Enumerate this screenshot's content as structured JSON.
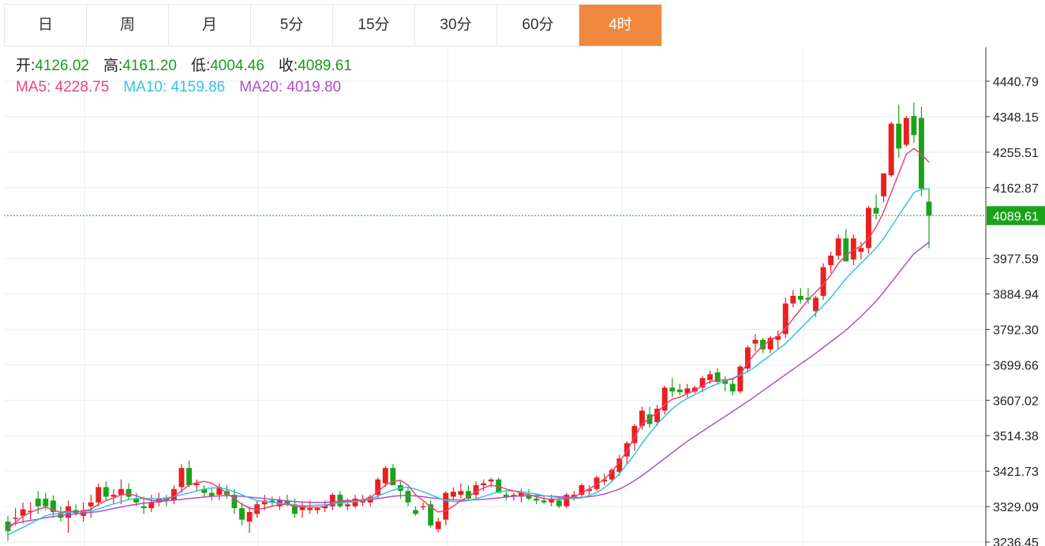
{
  "tabs": [
    "日",
    "周",
    "月",
    "5分",
    "15分",
    "30分",
    "60分",
    "4时"
  ],
  "active_tab": "4时",
  "ohlc": {
    "open_label": "开:",
    "open": "4126.02",
    "high_label": "高:",
    "high": "4161.20",
    "low_label": "低:",
    "low": "4004.46",
    "close_label": "收:",
    "close": "4089.61"
  },
  "ma": {
    "ma5_label": "MA5:",
    "ma5": "4228.75",
    "ma10_label": "MA10:",
    "ma10": "4159.86",
    "ma20_label": "MA20:",
    "ma20": "4019.80"
  },
  "colors": {
    "up": "#e8201f",
    "down": "#1aa31a",
    "ma5": "#e8457a",
    "ma10": "#33c4e0",
    "ma20": "#b14fc8",
    "active_tab": "#f08840",
    "price_tag": "#1aa31a",
    "grid": "#e8eef2"
  },
  "chart_data": {
    "type": "candlestick",
    "y_ticks": [
      "4440.79",
      "4348.15",
      "4255.51",
      "4162.87",
      "3977.59",
      "3884.94",
      "3792.30",
      "3699.66",
      "3607.02",
      "3514.38",
      "3421.73",
      "3329.09",
      "3236.45"
    ],
    "ylim": [
      3236.45,
      4440.79
    ],
    "current_price": "4089.61",
    "candles": [
      [
        3290,
        3305,
        3240,
        3265
      ],
      [
        3300,
        3325,
        3280,
        3300
      ],
      [
        3305,
        3340,
        3285,
        3322
      ],
      [
        3315,
        3340,
        3295,
        3318
      ],
      [
        3350,
        3370,
        3310,
        3330
      ],
      [
        3350,
        3365,
        3320,
        3330
      ],
      [
        3345,
        3358,
        3300,
        3315
      ],
      [
        3310,
        3330,
        3290,
        3300
      ],
      [
        3300,
        3345,
        3260,
        3330
      ],
      [
        3320,
        3335,
        3305,
        3312
      ],
      [
        3305,
        3340,
        3290,
        3320
      ],
      [
        3330,
        3360,
        3300,
        3340
      ],
      [
        3340,
        3390,
        3330,
        3380
      ],
      [
        3380,
        3395,
        3345,
        3355
      ],
      [
        3355,
        3375,
        3335,
        3360
      ],
      [
        3360,
        3400,
        3335,
        3375
      ],
      [
        3375,
        3390,
        3345,
        3355
      ],
      [
        3350,
        3365,
        3330,
        3340
      ],
      [
        3330,
        3355,
        3310,
        3325
      ],
      [
        3325,
        3360,
        3315,
        3340
      ],
      [
        3340,
        3365,
        3330,
        3350
      ],
      [
        3350,
        3360,
        3330,
        3345
      ],
      [
        3345,
        3385,
        3335,
        3375
      ],
      [
        3380,
        3440,
        3365,
        3430
      ],
      [
        3430,
        3450,
        3380,
        3385
      ],
      [
        3385,
        3400,
        3370,
        3390
      ],
      [
        3375,
        3385,
        3355,
        3365
      ],
      [
        3365,
        3380,
        3345,
        3355
      ],
      [
        3360,
        3390,
        3345,
        3380
      ],
      [
        3370,
        3385,
        3350,
        3360
      ],
      [
        3360,
        3375,
        3310,
        3325
      ],
      [
        3325,
        3340,
        3280,
        3295
      ],
      [
        3290,
        3330,
        3260,
        3315
      ],
      [
        3310,
        3345,
        3300,
        3335
      ],
      [
        3335,
        3360,
        3320,
        3345
      ],
      [
        3345,
        3355,
        3330,
        3340
      ],
      [
        3330,
        3355,
        3320,
        3345
      ],
      [
        3345,
        3360,
        3330,
        3335
      ],
      [
        3335,
        3350,
        3300,
        3310
      ],
      [
        3320,
        3340,
        3300,
        3330
      ],
      [
        3320,
        3345,
        3310,
        3325
      ],
      [
        3320,
        3330,
        3310,
        3325
      ],
      [
        3325,
        3345,
        3315,
        3330
      ],
      [
        3330,
        3365,
        3320,
        3360
      ],
      [
        3360,
        3370,
        3325,
        3330
      ],
      [
        3330,
        3350,
        3320,
        3335
      ],
      [
        3330,
        3360,
        3325,
        3350
      ],
      [
        3340,
        3360,
        3330,
        3345
      ],
      [
        3340,
        3360,
        3330,
        3355
      ],
      [
        3360,
        3405,
        3350,
        3400
      ],
      [
        3390,
        3435,
        3380,
        3430
      ],
      [
        3430,
        3440,
        3385,
        3385
      ],
      [
        3385,
        3395,
        3350,
        3370
      ],
      [
        3370,
        3380,
        3330,
        3340
      ],
      [
        3320,
        3330,
        3305,
        3310
      ],
      [
        3330,
        3340,
        3320,
        3330
      ],
      [
        3335,
        3345,
        3275,
        3280
      ],
      [
        3270,
        3300,
        3262,
        3290
      ],
      [
        3295,
        3370,
        3280,
        3365
      ],
      [
        3355,
        3380,
        3345,
        3368
      ],
      [
        3360,
        3390,
        3350,
        3370
      ],
      [
        3370,
        3385,
        3345,
        3350
      ],
      [
        3360,
        3395,
        3350,
        3385
      ],
      [
        3385,
        3400,
        3370,
        3390
      ],
      [
        3395,
        3405,
        3380,
        3400
      ],
      [
        3400,
        3405,
        3365,
        3365
      ],
      [
        3360,
        3370,
        3345,
        3355
      ],
      [
        3355,
        3365,
        3345,
        3360
      ],
      [
        3355,
        3375,
        3340,
        3365
      ],
      [
        3360,
        3375,
        3345,
        3350
      ],
      [
        3350,
        3360,
        3335,
        3345
      ],
      [
        3345,
        3355,
        3335,
        3340
      ],
      [
        3340,
        3360,
        3330,
        3350
      ],
      [
        3345,
        3355,
        3325,
        3330
      ],
      [
        3330,
        3365,
        3325,
        3360
      ],
      [
        3355,
        3370,
        3345,
        3360
      ],
      [
        3360,
        3390,
        3350,
        3385
      ],
      [
        3370,
        3385,
        3360,
        3375
      ],
      [
        3375,
        3410,
        3370,
        3405
      ],
      [
        3395,
        3415,
        3385,
        3400
      ],
      [
        3400,
        3430,
        3395,
        3425
      ],
      [
        3420,
        3465,
        3410,
        3455
      ],
      [
        3460,
        3500,
        3440,
        3495
      ],
      [
        3495,
        3545,
        3475,
        3540
      ],
      [
        3540,
        3590,
        3530,
        3580
      ],
      [
        3570,
        3590,
        3535,
        3545
      ],
      [
        3550,
        3595,
        3540,
        3585
      ],
      [
        3580,
        3645,
        3570,
        3640
      ],
      [
        3640,
        3665,
        3615,
        3630
      ],
      [
        3635,
        3650,
        3620,
        3628
      ],
      [
        3625,
        3650,
        3615,
        3638
      ],
      [
        3630,
        3645,
        3625,
        3640
      ],
      [
        3640,
        3670,
        3628,
        3665
      ],
      [
        3660,
        3685,
        3650,
        3675
      ],
      [
        3680,
        3690,
        3650,
        3655
      ],
      [
        3660,
        3670,
        3630,
        3650
      ],
      [
        3650,
        3665,
        3620,
        3630
      ],
      [
        3630,
        3700,
        3625,
        3695
      ],
      [
        3690,
        3750,
        3680,
        3745
      ],
      [
        3755,
        3780,
        3735,
        3765
      ],
      [
        3765,
        3770,
        3730,
        3740
      ],
      [
        3740,
        3775,
        3730,
        3770
      ],
      [
        3765,
        3790,
        3740,
        3775
      ],
      [
        3780,
        3875,
        3770,
        3860
      ],
      [
        3860,
        3895,
        3850,
        3880
      ],
      [
        3880,
        3900,
        3860,
        3870
      ],
      [
        3875,
        3900,
        3860,
        3870
      ],
      [
        3840,
        3880,
        3825,
        3875
      ],
      [
        3880,
        3965,
        3870,
        3955
      ],
      [
        3960,
        3995,
        3940,
        3985
      ],
      [
        3985,
        4040,
        3975,
        4030
      ],
      [
        4030,
        4055,
        3970,
        3970
      ],
      [
        3975,
        4040,
        3960,
        4030
      ],
      [
        3995,
        4020,
        3975,
        4005
      ],
      [
        4005,
        4115,
        3990,
        4110
      ],
      [
        4110,
        4145,
        4080,
        4095
      ],
      [
        4140,
        4200,
        4125,
        4200
      ],
      [
        4195,
        4335,
        4190,
        4330
      ],
      [
        4330,
        4380,
        4240,
        4265
      ],
      [
        4275,
        4350,
        4270,
        4345
      ],
      [
        4350,
        4385,
        4280,
        4300
      ],
      [
        4345,
        4375,
        4140,
        4160
      ],
      [
        4126.02,
        4161.2,
        4004.46,
        4089.61
      ]
    ],
    "ma5": [
      3270,
      3288,
      3304,
      3314,
      3322,
      3328,
      3320,
      3314,
      3318,
      3315,
      3318,
      3322,
      3335,
      3345,
      3352,
      3360,
      3362,
      3358,
      3350,
      3345,
      3345,
      3348,
      3355,
      3370,
      3385,
      3392,
      3395,
      3390,
      3378,
      3365,
      3350,
      3335,
      3325,
      3322,
      3325,
      3330,
      3335,
      3335,
      3330,
      3328,
      3328,
      3327,
      3330,
      3338,
      3345,
      3345,
      3345,
      3347,
      3352,
      3368,
      3385,
      3395,
      3398,
      3385,
      3360,
      3345,
      3328,
      3315,
      3318,
      3330,
      3345,
      3355,
      3368,
      3378,
      3385,
      3382,
      3375,
      3370,
      3365,
      3360,
      3355,
      3350,
      3348,
      3348,
      3350,
      3355,
      3365,
      3375,
      3388,
      3400,
      3420,
      3445,
      3475,
      3510,
      3545,
      3560,
      3575,
      3595,
      3610,
      3615,
      3625,
      3632,
      3645,
      3655,
      3660,
      3660,
      3662,
      3675,
      3705,
      3730,
      3750,
      3765,
      3775,
      3795,
      3820,
      3845,
      3870,
      3890,
      3910,
      3935,
      3965,
      3985,
      4000,
      4010,
      4030,
      4060,
      4100,
      4150,
      4200,
      4250,
      4265,
      4250,
      4229
    ],
    "ma10": [
      3255,
      3265,
      3275,
      3285,
      3295,
      3305,
      3310,
      3312,
      3314,
      3315,
      3316,
      3318,
      3323,
      3330,
      3336,
      3342,
      3348,
      3350,
      3350,
      3350,
      3350,
      3352,
      3355,
      3360,
      3365,
      3370,
      3375,
      3378,
      3378,
      3375,
      3368,
      3360,
      3352,
      3345,
      3342,
      3340,
      3338,
      3336,
      3333,
      3332,
      3332,
      3333,
      3334,
      3336,
      3338,
      3340,
      3342,
      3345,
      3350,
      3356,
      3365,
      3372,
      3378,
      3380,
      3375,
      3368,
      3360,
      3352,
      3345,
      3342,
      3342,
      3345,
      3350,
      3355,
      3362,
      3368,
      3370,
      3370,
      3368,
      3365,
      3362,
      3358,
      3355,
      3352,
      3350,
      3350,
      3352,
      3358,
      3366,
      3378,
      3395,
      3415,
      3440,
      3465,
      3495,
      3520,
      3545,
      3565,
      3585,
      3600,
      3612,
      3622,
      3632,
      3642,
      3650,
      3658,
      3665,
      3672,
      3682,
      3695,
      3710,
      3725,
      3740,
      3755,
      3775,
      3795,
      3815,
      3835,
      3855,
      3875,
      3900,
      3925,
      3945,
      3965,
      3985,
      4005,
      4030,
      4060,
      4090,
      4120,
      4150,
      4158,
      4160
    ],
    "ma20": [
      3280,
      3285,
      3290,
      3293,
      3296,
      3300,
      3303,
      3306,
      3308,
      3310,
      3312,
      3314,
      3316,
      3320,
      3324,
      3328,
      3332,
      3335,
      3338,
      3340,
      3342,
      3344,
      3346,
      3348,
      3350,
      3352,
      3354,
      3356,
      3357,
      3358,
      3357,
      3356,
      3354,
      3352,
      3350,
      3348,
      3346,
      3344,
      3342,
      3341,
      3340,
      3340,
      3340,
      3341,
      3342,
      3343,
      3344,
      3345,
      3347,
      3350,
      3353,
      3356,
      3358,
      3358,
      3357,
      3355,
      3352,
      3350,
      3348,
      3347,
      3346,
      3346,
      3347,
      3348,
      3350,
      3352,
      3354,
      3356,
      3357,
      3358,
      3358,
      3357,
      3356,
      3355,
      3354,
      3353,
      3353,
      3355,
      3358,
      3362,
      3368,
      3375,
      3385,
      3397,
      3410,
      3425,
      3440,
      3455,
      3470,
      3485,
      3500,
      3513,
      3526,
      3539,
      3552,
      3565,
      3578,
      3591,
      3604,
      3618,
      3632,
      3646,
      3660,
      3674,
      3688,
      3702,
      3716,
      3730,
      3745,
      3760,
      3775,
      3790,
      3808,
      3826,
      3846,
      3866,
      3890,
      3915,
      3940,
      3965,
      3990,
      4005,
      4020
    ]
  }
}
